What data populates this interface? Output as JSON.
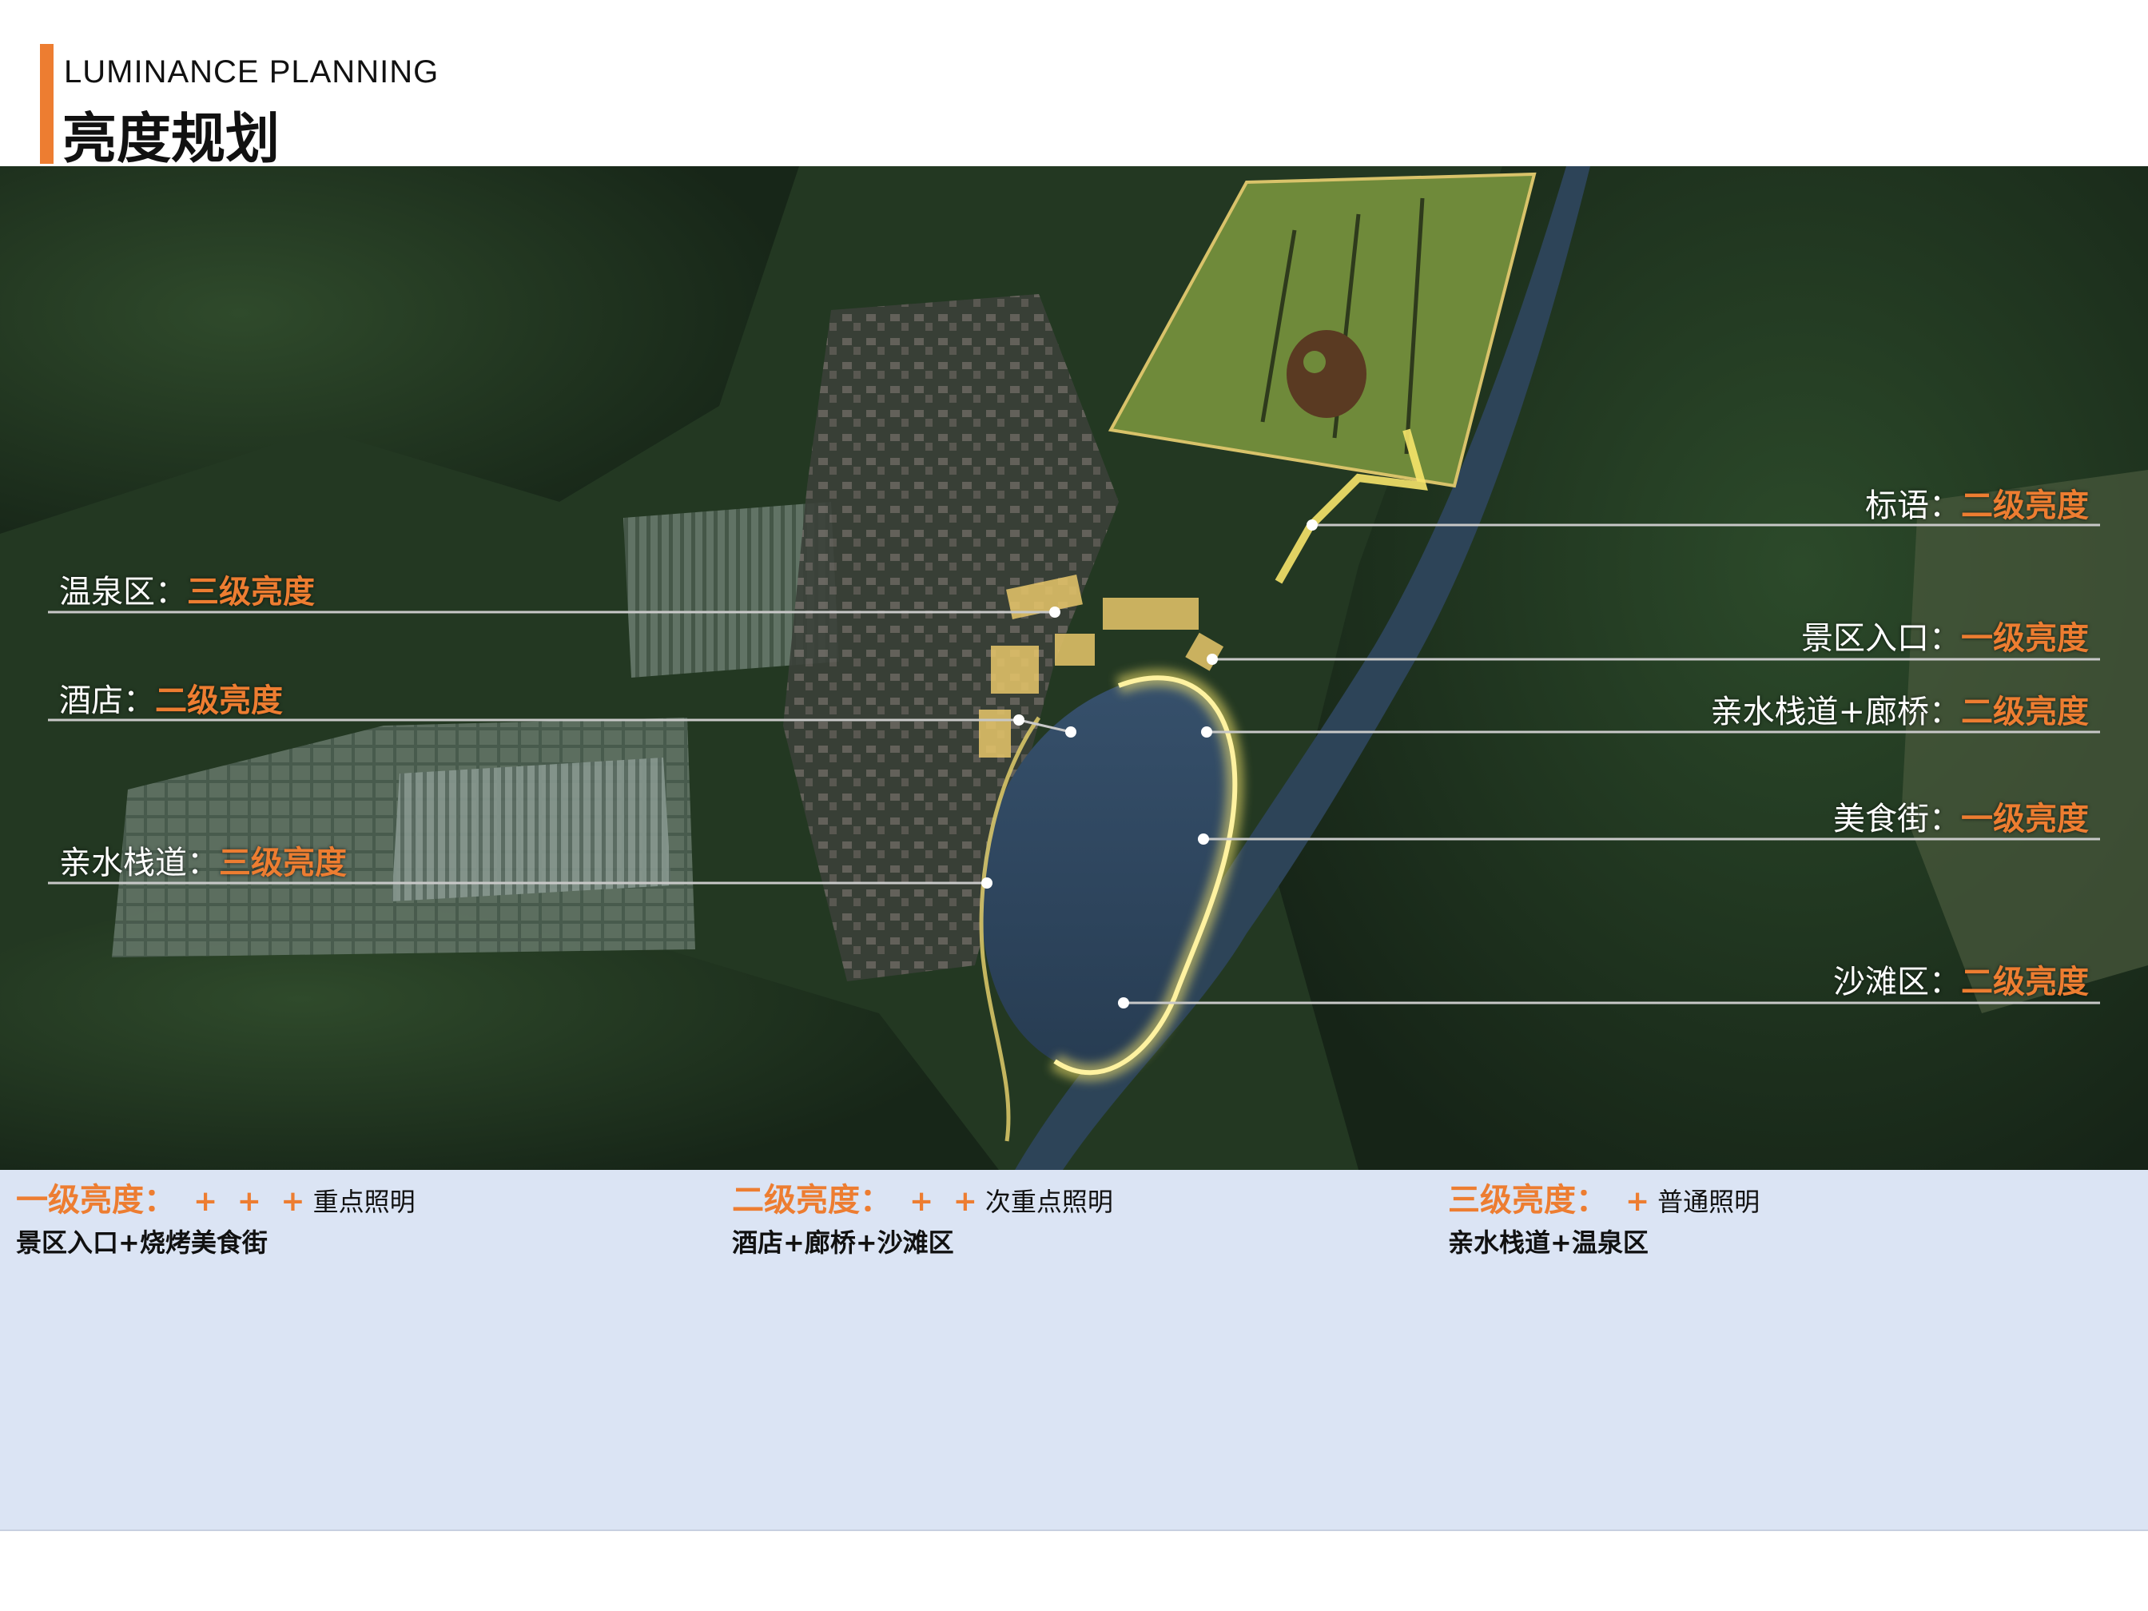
{
  "header": {
    "subtitle": "LUMINANCE PLANNING",
    "title": "亮度规划"
  },
  "colors": {
    "accent": "#ed7d31",
    "legend_bg": "#dbe4f4",
    "callout_line": "#c8c8c8",
    "lit_path": "#f3e27a"
  },
  "callouts": {
    "slogan": {
      "name": "标语：",
      "level": "二级亮度"
    },
    "scenic_entry": {
      "name": "景区入口：",
      "level": "一级亮度"
    },
    "waterfront_bridge": {
      "name": "亲水栈道+廊桥：",
      "level": "二级亮度"
    },
    "food_street": {
      "name": "美食街：",
      "level": "一级亮度"
    },
    "beach": {
      "name": "沙滩区：",
      "level": "二级亮度"
    },
    "hot_spring": {
      "name": "温泉区：",
      "level": "三级亮度"
    },
    "hotel": {
      "name": "酒店：",
      "level": "二级亮度"
    },
    "waterfront": {
      "name": "亲水栈道：",
      "level": "三级亮度"
    }
  },
  "legend": [
    {
      "level": "一级亮度：",
      "plus": "+ + +",
      "desc": "重点照明",
      "areas": "景区入口+烧烤美食街"
    },
    {
      "level": "二级亮度：",
      "plus": "+ +",
      "desc": "次重点照明",
      "areas": "酒店+廊桥+沙滩区"
    },
    {
      "level": "三级亮度：",
      "plus": "+",
      "desc": "普通照明",
      "areas": "亲水栈道+温泉区"
    }
  ]
}
